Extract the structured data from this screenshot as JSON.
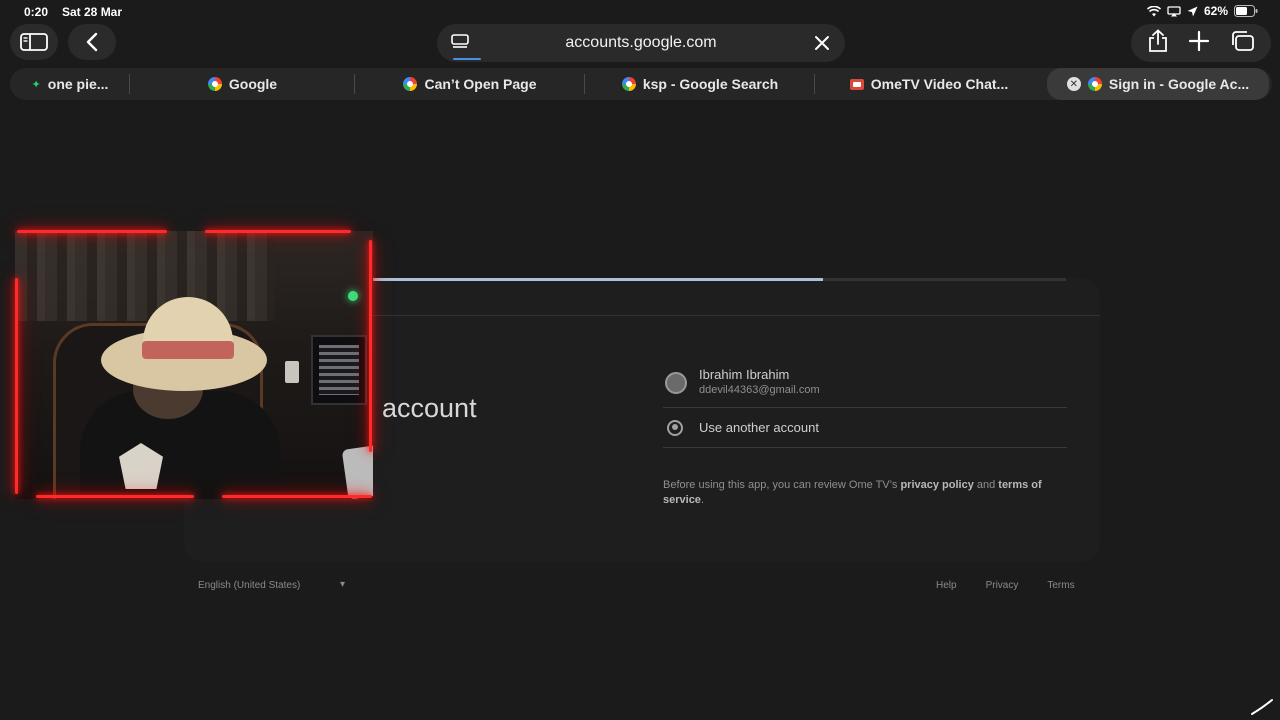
{
  "status_bar": {
    "time": "0:20",
    "date": "Sat 28 Mar",
    "battery": "62%"
  },
  "toolbar": {
    "url": "accounts.google.com",
    "icons": [
      "sidebar-icon",
      "back-icon",
      "page-menu-icon",
      "close-icon",
      "share-icon",
      "plus-icon",
      "tabs-icon"
    ]
  },
  "tabs": [
    {
      "label": "one pie...",
      "icon": "spark-icon"
    },
    {
      "label": "Google",
      "icon": "google-icon"
    },
    {
      "label": "Can’t Open Page",
      "icon": "google-icon"
    },
    {
      "label": "ksp - Google Search",
      "icon": "google-icon"
    },
    {
      "label": "OmeTV Video Chat...",
      "icon": "ometv-icon"
    },
    {
      "label": "Sign in - Google Ac...",
      "icon": "google-icon",
      "active": true
    }
  ],
  "page": {
    "progress": 0.65,
    "heading": "account",
    "account": {
      "name": "Ibrahim Ibrahim",
      "email": "ddevil44363@gmail.com"
    },
    "use_another": "Use another account",
    "disclaimer_prefix": "Before using this app, you can review Ome TV’s ",
    "privacy_link": "privacy policy",
    "disclaimer_mid": " and ",
    "terms_link": "terms of service",
    "disclaimer_suffix": "."
  },
  "footer": {
    "language": "English (United States)",
    "help": "Help",
    "privacy": "Privacy",
    "terms": "Terms"
  },
  "colors": {
    "background": "#1b1b1b",
    "neon_frame": "#ff2a2a",
    "progress": "#a9c1d9"
  }
}
